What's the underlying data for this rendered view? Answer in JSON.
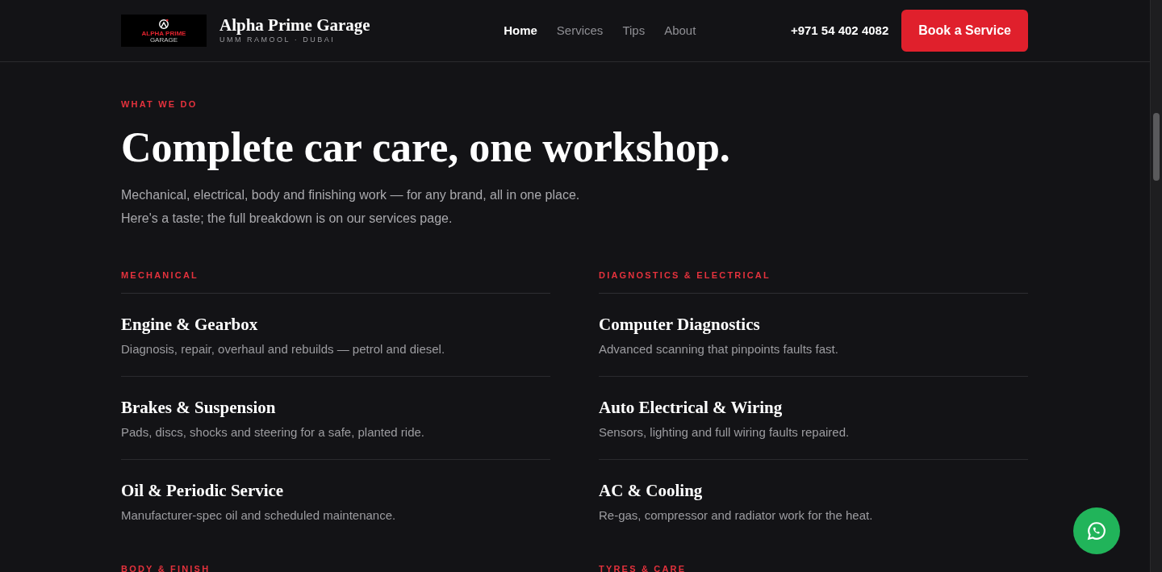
{
  "header": {
    "logo": {
      "line_1": "ALPHA PRIME",
      "line_2": "GARAGE"
    },
    "brand": "Alpha Prime Garage",
    "tagline": "UMM RAMOOL · DUBAI",
    "nav": [
      {
        "label": "Home",
        "selected": true
      },
      {
        "label": "Services",
        "selected": false
      },
      {
        "label": "Tips",
        "selected": false
      },
      {
        "label": "About",
        "selected": false
      }
    ],
    "phone": "+971 54 402 4082",
    "cta": "Book a Service"
  },
  "section": {
    "eyebrow": "WHAT WE DO",
    "title": "Complete car care, one workshop.",
    "intro": [
      "Mechanical, electrical, body and finishing work — for any brand, all in one place.",
      "Here's a taste; the full breakdown is on our services page."
    ],
    "groups": [
      {
        "heading": "MECHANICAL",
        "items": [
          {
            "title": "Engine & Gearbox",
            "text": "Diagnosis, repair, overhaul and rebuilds — petrol and diesel."
          },
          {
            "title": "Brakes & Suspension",
            "text": "Pads, discs, shocks and steering for a safe, planted ride."
          },
          {
            "title": "Oil & Periodic Service",
            "text": "Manufacturer-spec oil and scheduled maintenance."
          }
        ]
      },
      {
        "heading": "DIAGNOSTICS & ELECTRICAL",
        "items": [
          {
            "title": "Computer Diagnostics",
            "text": "Advanced scanning that pinpoints faults fast."
          },
          {
            "title": "Auto Electrical & Wiring",
            "text": "Sensors, lighting and full wiring faults repaired."
          },
          {
            "title": "AC & Cooling",
            "text": "Re-gas, compressor and radiator work for the heat."
          }
        ]
      },
      {
        "heading": "BODY & FINISH"
      },
      {
        "heading": "TYRES & CARE"
      }
    ]
  }
}
